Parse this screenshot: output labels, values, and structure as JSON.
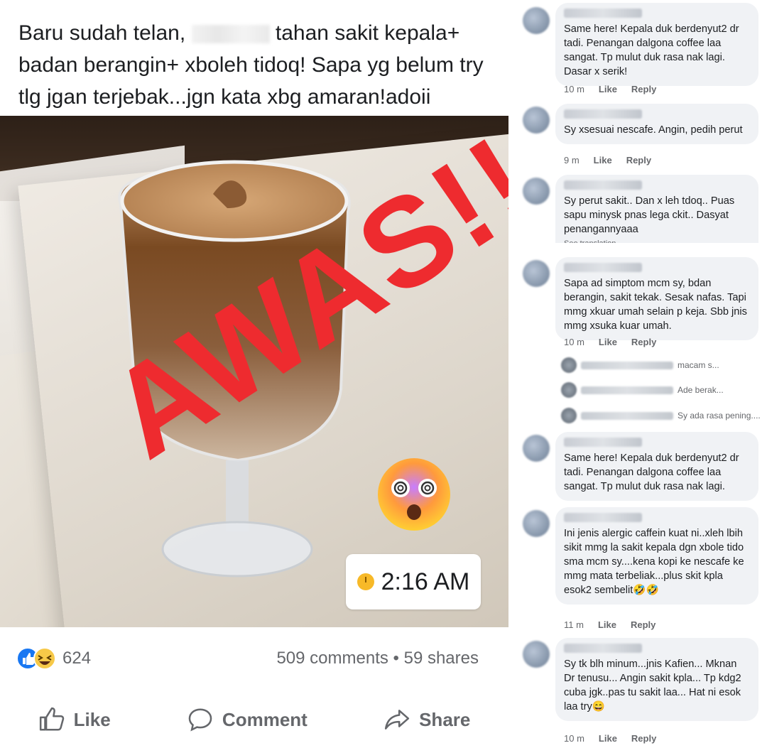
{
  "post": {
    "caption_part1": "Baru sudah telan",
    "caption_part2": "tahan sakit kepala+ badan berangin+ xboleh tidoq! Sapa yg belum try tlg jgan terjebak...jgn kata xbg amaran!adoii",
    "overlay_text": "AWAS!!",
    "time_badge": "2:16 AM",
    "reaction_count": "624",
    "comments_shares": "509 comments • 59 shares",
    "actions": {
      "like": "Like",
      "comment": "Comment",
      "share": "Share"
    }
  },
  "colors": {
    "awas_red": "#ee2b2f",
    "fb_blue": "#1877f2",
    "bubble_bg": "#f0f2f5",
    "meta_gray": "#65676b"
  },
  "comments": [
    {
      "text": "Same here! Kepala duk berdenyut2 dr tadi. Penangan dalgona coffee laa sangat. Tp mulut duk rasa nak lagi. Dasar x serik!",
      "time": "10 m",
      "like": "Like",
      "reply": "Reply"
    },
    {
      "text": "Sy xsesuai nescafe. Angin, pedih perut",
      "time": "9 m",
      "like": "Like",
      "reply": "Reply"
    },
    {
      "text": "Sy perut sakit.. Dan x leh tdoq.. Puas sapu minysk pnas lega ckit.. Dasyat penangannyaaa",
      "subtext": "See translation"
    },
    {
      "text": "Sapa ad simptom mcm sy, bdan berangin, sakit tekak. Sesak nafas. Tapi mmg xkuar umah selain p keja. Sbb jnis mmg xsuka kuar umah.",
      "time": "10 m",
      "like": "Like",
      "reply": "Reply"
    },
    {
      "text": "Same here! Kepala duk berdenyut2 dr tadi. Penangan dalgona coffee laa sangat. Tp mulut duk rasa nak lagi."
    },
    {
      "text": "Ini jenis alergic caffein kuat ni..xleh lbih sikit mmg la sakit kepala dgn xbole tido sma mcm sy....kena kopi ke nescafe ke mmg mata terbeliak...plus skit kpla esok2 sembelit🤣🤣",
      "time": "11 m",
      "like": "Like",
      "reply": "Reply"
    },
    {
      "text": "Sy tk blh minum...jnis Kafien... Mknan Dr tenusu... Angin sakit kpla... Tp kdg2 cuba jgk..pas tu sakit laa... Hat ni esok laa try😄",
      "time": "10 m",
      "like": "Like",
      "reply": "Reply"
    }
  ],
  "replies": [
    {
      "snippet": "macam s..."
    },
    {
      "snippet": "Ade berak..."
    },
    {
      "snippet": "Sy ada rasa pening...."
    }
  ]
}
